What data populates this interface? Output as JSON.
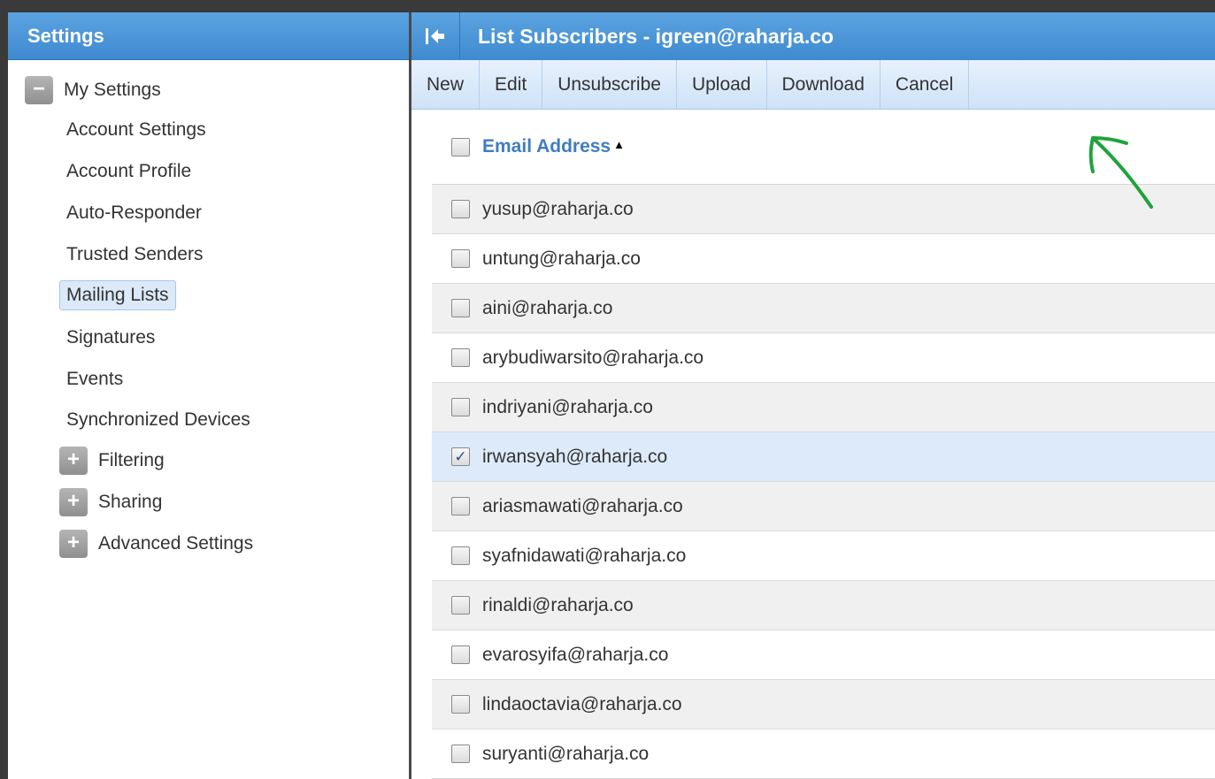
{
  "settings_panel": {
    "title": "Settings",
    "root": {
      "label": "My Settings",
      "toggle": "−"
    },
    "items": [
      {
        "label": "Account Settings",
        "selected": false
      },
      {
        "label": "Account Profile",
        "selected": false
      },
      {
        "label": "Auto-Responder",
        "selected": false
      },
      {
        "label": "Trusted Senders",
        "selected": false
      },
      {
        "label": "Mailing Lists",
        "selected": true
      },
      {
        "label": "Signatures",
        "selected": false
      },
      {
        "label": "Events",
        "selected": false
      },
      {
        "label": "Synchronized Devices",
        "selected": false
      }
    ],
    "groups": [
      {
        "label": "Filtering",
        "toggle": "+"
      },
      {
        "label": "Sharing",
        "toggle": "+"
      },
      {
        "label": "Advanced Settings",
        "toggle": "+"
      }
    ]
  },
  "main": {
    "title": "List Subscribers - igreen@raharja.co",
    "toolbar": {
      "new": "New",
      "edit": "Edit",
      "unsubscribe": "Unsubscribe",
      "upload": "Upload",
      "download": "Download",
      "cancel": "Cancel"
    },
    "grid": {
      "column": "Email Address",
      "sort": "ascending",
      "rows": [
        {
          "email": "yusup@raharja.co",
          "checked": false
        },
        {
          "email": "untung@raharja.co",
          "checked": false
        },
        {
          "email": "aini@raharja.co",
          "checked": false
        },
        {
          "email": "arybudiwarsito@raharja.co",
          "checked": false
        },
        {
          "email": "indriyani@raharja.co",
          "checked": false
        },
        {
          "email": "irwansyah@raharja.co",
          "checked": true
        },
        {
          "email": "ariasmawati@raharja.co",
          "checked": false
        },
        {
          "email": "syafnidawati@raharja.co",
          "checked": false
        },
        {
          "email": "rinaldi@raharja.co",
          "checked": false
        },
        {
          "email": "evarosyifa@raharja.co",
          "checked": false
        },
        {
          "email": "lindaoctavia@raharja.co",
          "checked": false
        },
        {
          "email": "suryanti@raharja.co",
          "checked": false
        }
      ]
    }
  },
  "colors": {
    "header_blue": "#4a94d8",
    "toolbar_blue": "#d9e8f9",
    "annotation_green": "#1fa33a",
    "link_blue": "#3f7dbf"
  },
  "icons": {
    "collapse": "collapse-left-icon",
    "sort": "sort-ascending-icon",
    "annotation": "annotation-arrow-icon"
  }
}
